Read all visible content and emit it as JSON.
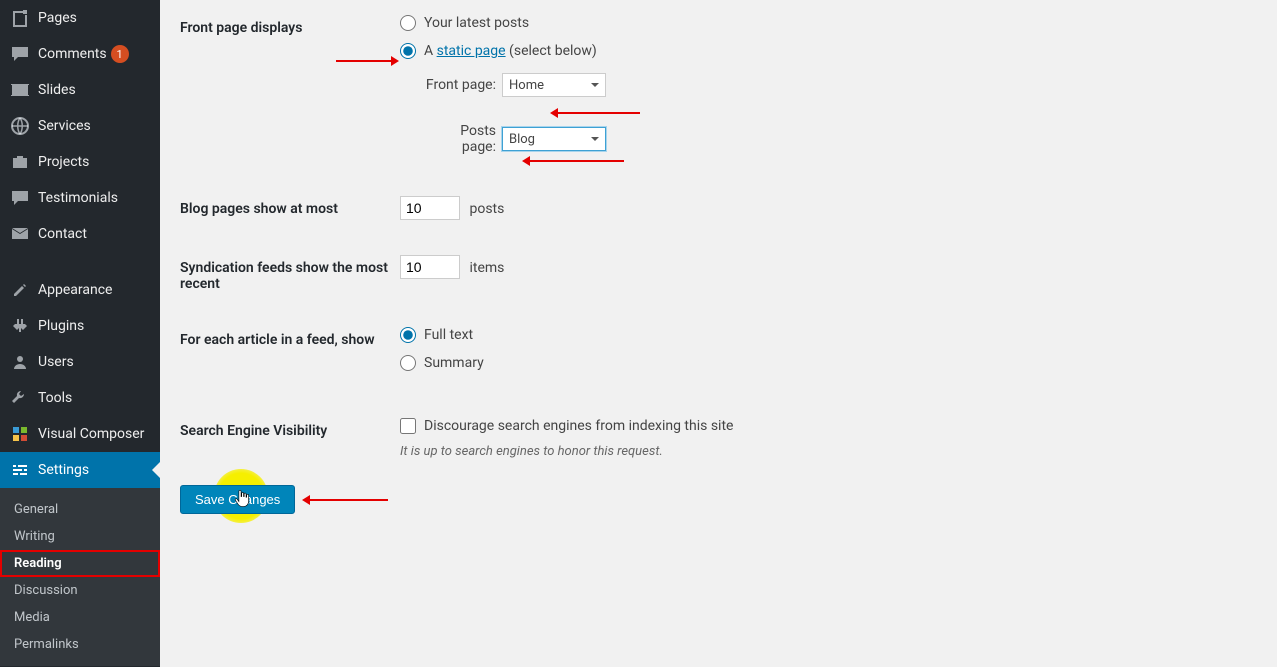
{
  "sidebar": {
    "items": [
      {
        "label": "Pages",
        "icon": "pages"
      },
      {
        "label": "Comments",
        "icon": "comments",
        "badge": "1"
      },
      {
        "label": "Slides",
        "icon": "slides"
      },
      {
        "label": "Services",
        "icon": "services"
      },
      {
        "label": "Projects",
        "icon": "projects"
      },
      {
        "label": "Testimonials",
        "icon": "testimonials"
      },
      {
        "label": "Contact",
        "icon": "contact"
      }
    ],
    "items2": [
      {
        "label": "Appearance",
        "icon": "appearance"
      },
      {
        "label": "Plugins",
        "icon": "plugins"
      },
      {
        "label": "Users",
        "icon": "users"
      },
      {
        "label": "Tools",
        "icon": "tools"
      },
      {
        "label": "Visual Composer",
        "icon": "vc"
      },
      {
        "label": "Settings",
        "icon": "settings",
        "active": true
      }
    ],
    "submenu": [
      {
        "label": "General"
      },
      {
        "label": "Writing"
      },
      {
        "label": "Reading",
        "highlight": true
      },
      {
        "label": "Discussion"
      },
      {
        "label": "Media"
      },
      {
        "label": "Permalinks"
      }
    ]
  },
  "settings": {
    "front_page_displays": {
      "heading": "Front page displays",
      "opt_latest": "Your latest posts",
      "opt_static_prefix": "A ",
      "opt_static_link": "static page",
      "opt_static_suffix": " (select below)",
      "front_page_label": "Front page:",
      "front_page_value": "Home",
      "posts_page_label": "Posts page:",
      "posts_page_value": "Blog"
    },
    "blog_pages": {
      "heading": "Blog pages show at most",
      "value": "10",
      "unit": "posts"
    },
    "syndication": {
      "heading": "Syndication feeds show the most recent",
      "value": "10",
      "unit": "items"
    },
    "feed_format": {
      "heading": "For each article in a feed, show",
      "full": "Full text",
      "summary": "Summary"
    },
    "sev": {
      "heading": "Search Engine Visibility",
      "checkbox_label": "Discourage search engines from indexing this site",
      "note": "It is up to search engines to honor this request."
    },
    "save_label": "Save Changes"
  }
}
